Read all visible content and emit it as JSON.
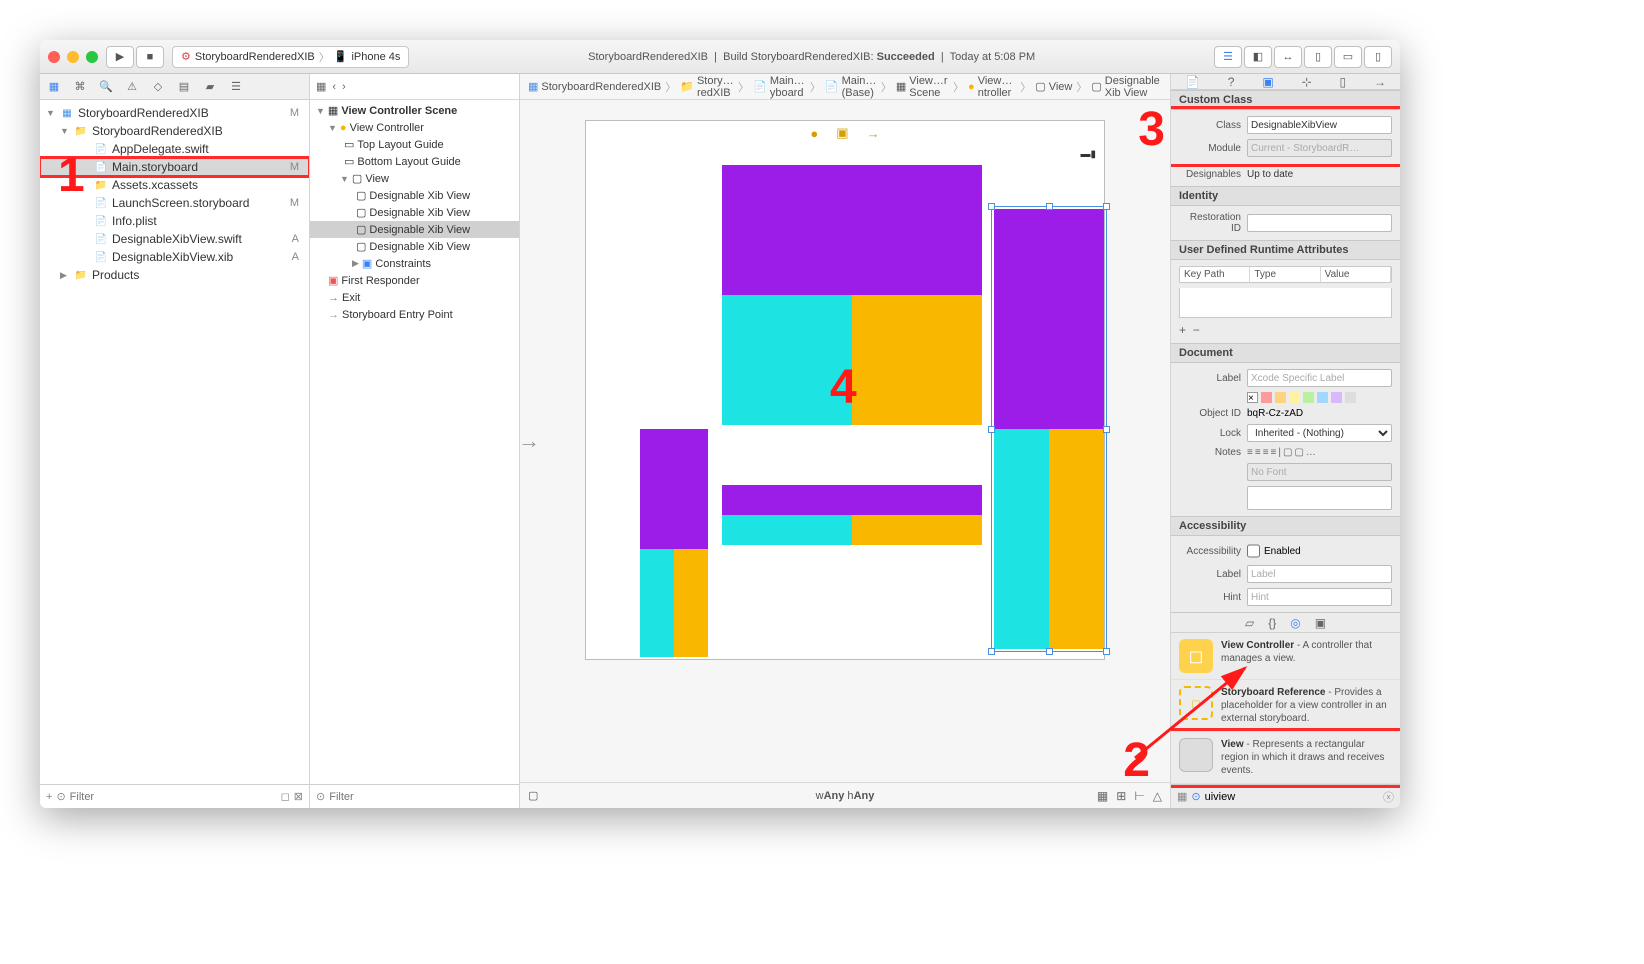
{
  "titlebar": {
    "scheme_project": "StoryboardRenderedXIB",
    "scheme_device": "iPhone 4s",
    "status_project": "StoryboardRenderedXIB",
    "status_action": "Build StoryboardRenderedXIB:",
    "status_result": "Succeeded",
    "status_time": "Today at 5:08 PM"
  },
  "navigator": {
    "root": "StoryboardRenderedXIB",
    "group": "StoryboardRenderedXIB",
    "items": [
      {
        "label": "AppDelegate.swift",
        "badge": ""
      },
      {
        "label": "Main.storyboard",
        "badge": "M"
      },
      {
        "label": "Assets.xcassets",
        "badge": ""
      },
      {
        "label": "LaunchScreen.storyboard",
        "badge": "M"
      },
      {
        "label": "Info.plist",
        "badge": ""
      },
      {
        "label": "DesignableXibView.swift",
        "badge": "A"
      },
      {
        "label": "DesignableXibView.xib",
        "badge": "A"
      }
    ],
    "products": "Products",
    "root_badge": "M",
    "filter_placeholder": "Filter"
  },
  "outline": {
    "scene": "View Controller Scene",
    "vc": "View Controller",
    "tlg": "Top Layout Guide",
    "blg": "Bottom Layout Guide",
    "view": "View",
    "dxv": "Designable Xib View",
    "constraints": "Constraints",
    "fr": "First Responder",
    "exit": "Exit",
    "sep": "Storyboard Entry Point"
  },
  "breadcrumb": {
    "p": "StoryboardRenderedXIB",
    "s": "Story…redXIB",
    "m": "Main…yboard",
    "mb": "Main…(Base)",
    "vcs": "View…r Scene",
    "vc": "View…ntroller",
    "v": "View",
    "dxv": "Designable Xib View"
  },
  "canvas": {
    "size_class": "wAny hAny"
  },
  "inspector": {
    "custom_class_h": "Custom Class",
    "class_label": "Class",
    "class_value": "DesignableXibView",
    "module_label": "Module",
    "module_placeholder": "Current - StoryboardR…",
    "designables_label": "Designables",
    "designables_value": "Up to date",
    "identity_h": "Identity",
    "restoration_label": "Restoration ID",
    "udra_h": "User Defined Runtime Attributes",
    "keypath": "Key Path",
    "type": "Type",
    "value": "Value",
    "document_h": "Document",
    "doc_label": "Label",
    "doc_label_ph": "Xcode Specific Label",
    "objid_label": "Object ID",
    "objid_value": "bqR-Cz-zAD",
    "lock_label": "Lock",
    "lock_value": "Inherited - (Nothing)",
    "notes_label": "Notes",
    "nofont": "No Font",
    "access_h": "Accessibility",
    "access_label": "Accessibility",
    "enabled_label": "Enabled",
    "acc_label": "Label",
    "acc_label_ph": "Label",
    "hint_label": "Hint",
    "hint_ph": "Hint"
  },
  "library": {
    "vc_title": "View Controller",
    "vc_desc": " - A controller that manages a view.",
    "sr_title": "Storyboard Reference",
    "sr_desc": " - Provides a placeholder for a view controller in an external storyboard.",
    "view_title": "View",
    "view_desc": " - Represents a rectangular region in which it draws and receives events.",
    "filter_value": "uiview"
  },
  "annotations": {
    "a1": "1",
    "a2": "2",
    "a3": "3",
    "a4": "4"
  }
}
